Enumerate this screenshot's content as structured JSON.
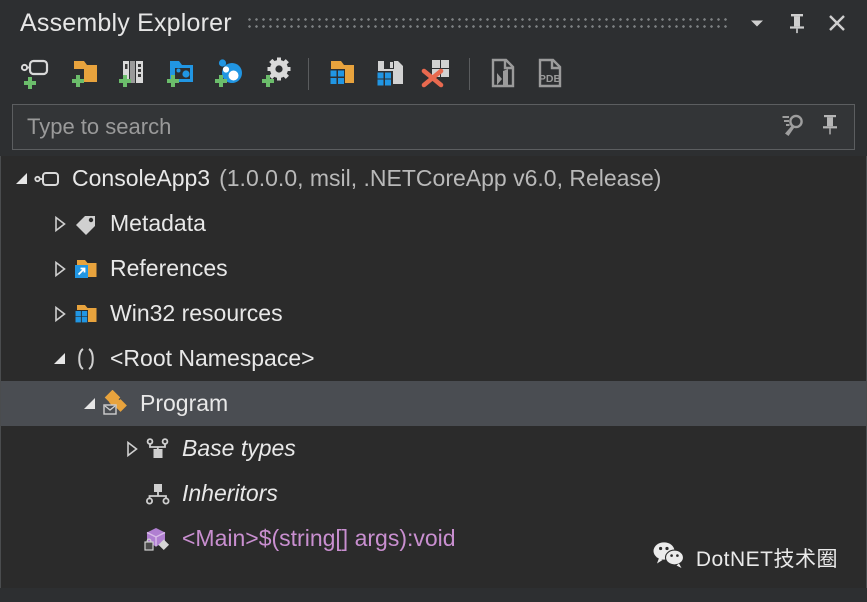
{
  "window": {
    "title": "Assembly Explorer",
    "controls": [
      {
        "name": "chevron-down-icon",
        "label": "Options"
      },
      {
        "name": "pin-icon",
        "label": "Pin"
      },
      {
        "name": "close-icon",
        "label": "Close"
      }
    ]
  },
  "toolbar": {
    "items": [
      {
        "name": "add-assembly-icon",
        "label": "Add Assembly"
      },
      {
        "name": "add-folder-icon",
        "label": "Open Folder"
      },
      {
        "name": "add-from-gac-icon",
        "label": "Add from GAC"
      },
      {
        "name": "add-process-icon",
        "label": "Add from Process"
      },
      {
        "name": "add-nuget-package-icon",
        "label": "Add NuGet Package"
      },
      {
        "name": "add-settings-icon",
        "label": "Options"
      },
      {
        "name": "separator-1",
        "label": ""
      },
      {
        "name": "open-solution-folder-icon",
        "label": "Open in Solution"
      },
      {
        "name": "save-assembly-icon",
        "label": "Save Assembly"
      },
      {
        "name": "remove-assembly-icon",
        "label": "Remove Assembly"
      },
      {
        "name": "separator-2",
        "label": ""
      },
      {
        "name": "export-sources-icon",
        "label": "Export Sources"
      },
      {
        "name": "pdb-icon",
        "label": "Load PDB"
      }
    ]
  },
  "search": {
    "placeholder": "Type to search",
    "value": "",
    "icons": [
      {
        "name": "search-options-icon",
        "label": "Search options"
      },
      {
        "name": "pin-search-icon",
        "label": "Pin search"
      }
    ]
  },
  "tree": {
    "nodes": [
      {
        "name": "ConsoleApp3",
        "detail": "(1.0.0.0, msil, .NETCoreApp v6.0, Release)",
        "icon": "assembly-icon",
        "expander": "expanded",
        "indent": 0,
        "italic": false,
        "selected": false,
        "color": "default"
      },
      {
        "name": "Metadata",
        "detail": "",
        "icon": "metadata-tag-icon",
        "expander": "collapsed",
        "indent": 1,
        "italic": false,
        "selected": false,
        "color": "default"
      },
      {
        "name": "References",
        "detail": "",
        "icon": "references-folder-icon",
        "expander": "collapsed",
        "indent": 1,
        "italic": false,
        "selected": false,
        "color": "default"
      },
      {
        "name": "Win32 resources",
        "detail": "",
        "icon": "resources-folder-icon",
        "expander": "collapsed",
        "indent": 1,
        "italic": false,
        "selected": false,
        "color": "default"
      },
      {
        "name": "<Root Namespace>",
        "detail": "",
        "icon": "namespace-icon",
        "expander": "expanded",
        "indent": 1,
        "italic": false,
        "selected": false,
        "color": "default"
      },
      {
        "name": "Program",
        "detail": "",
        "icon": "class-internal-icon",
        "expander": "expanded",
        "indent": 2,
        "italic": false,
        "selected": true,
        "color": "default"
      },
      {
        "name": "Base types",
        "detail": "",
        "icon": "base-types-icon",
        "expander": "collapsed",
        "indent": 3,
        "italic": true,
        "selected": false,
        "color": "default"
      },
      {
        "name": "Inheritors",
        "detail": "",
        "icon": "inheritors-icon",
        "expander": "none",
        "indent": 3,
        "italic": true,
        "selected": false,
        "color": "default"
      },
      {
        "name": "<Main>$(string[] args):void",
        "detail": "",
        "icon": "method-private-icon",
        "expander": "none",
        "indent": 3,
        "italic": false,
        "selected": false,
        "color": "purple"
      }
    ]
  },
  "watermark": {
    "text": "DotNET技术圈",
    "icon": "wechat-icon"
  },
  "colors": {
    "window_bg": "#2d2f31",
    "tree_bg": "#2b2b2b",
    "selection": "#4a4d52",
    "accent_orange": "#e8a33d",
    "accent_blue": "#2196e3",
    "accent_green": "#6bbd6b",
    "accent_purple": "#c98fd0",
    "text": "#e8e8e8",
    "muted_text": "#b9b9b9"
  }
}
